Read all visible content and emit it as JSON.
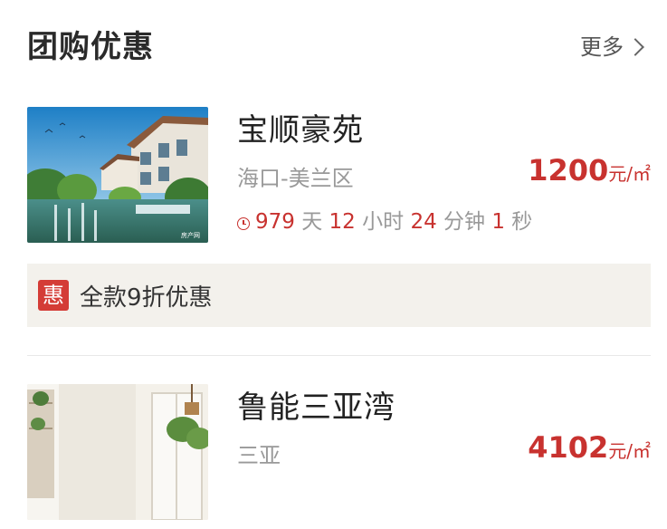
{
  "header": {
    "title": "团购优惠",
    "more_label": "更多"
  },
  "listings": [
    {
      "name": "宝顺豪苑",
      "district": "海口-美兰区",
      "price": "1200",
      "unit": "元/㎡",
      "countdown": {
        "days": "979",
        "days_unit": "天",
        "hours": "12",
        "hours_unit": "小时",
        "minutes": "24",
        "minutes_unit": "分钟",
        "seconds": "1",
        "seconds_unit": "秒"
      },
      "promo": {
        "badge": "惠",
        "text": "全款9折优惠"
      },
      "thumb_watermark": "房产网"
    },
    {
      "name": "鲁能三亚湾",
      "district": "三亚",
      "price": "4102",
      "unit": "元/㎡"
    }
  ],
  "colors": {
    "accent_red": "#c8322f",
    "promo_bg": "#f3f1ec",
    "badge_red": "#d43c36"
  }
}
